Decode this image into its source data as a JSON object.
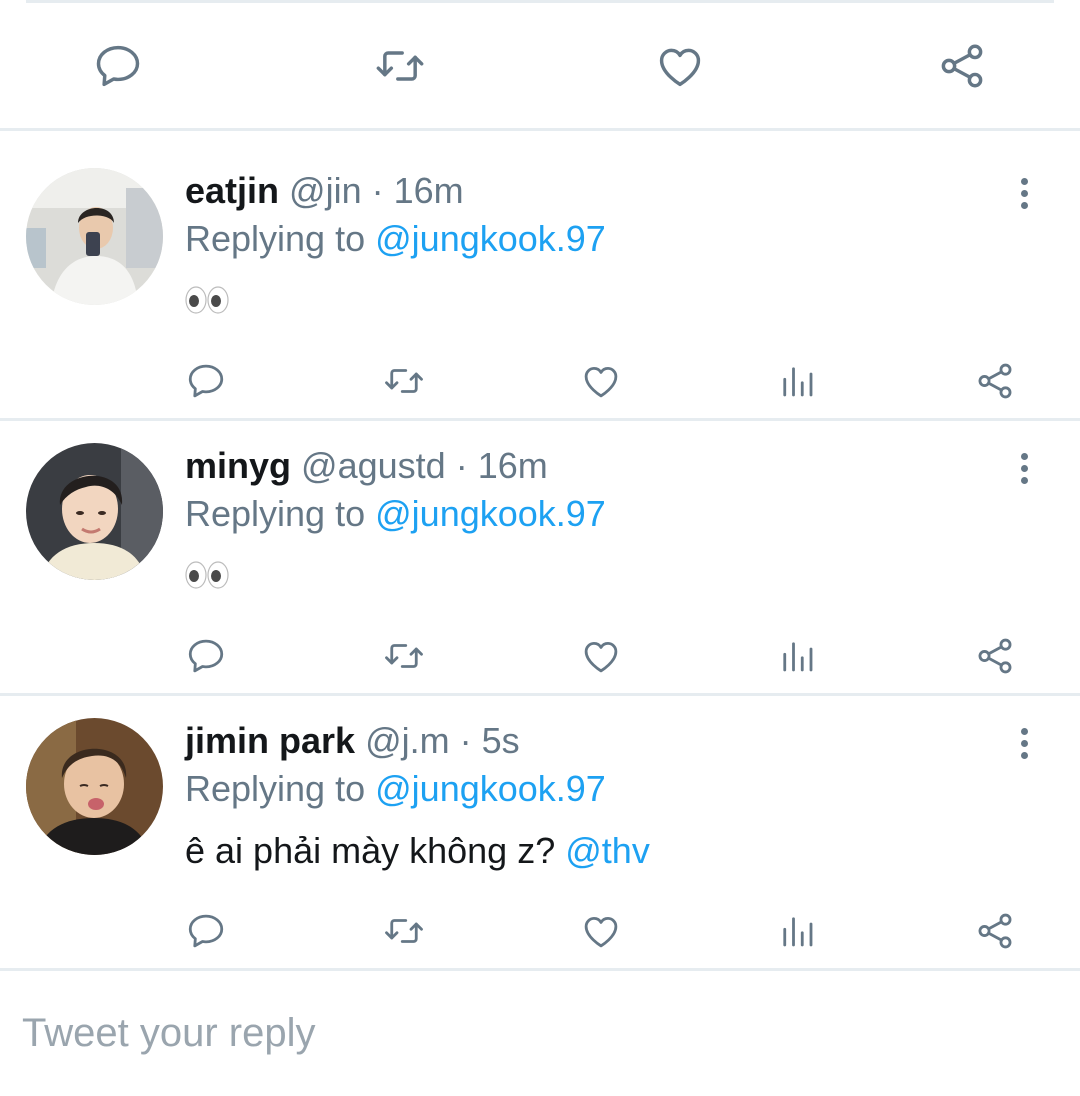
{
  "colors": {
    "icon": "#657786",
    "link": "#1da1f2",
    "separator": "#e6ecf0",
    "text": "#14171a"
  },
  "main_actions": [
    "reply-icon",
    "retweet-icon",
    "like-icon",
    "share-icon"
  ],
  "tweets": [
    {
      "name": "eatjin",
      "handle": "@jin",
      "sep": "·",
      "time": "16m",
      "replying_prefix": "Replying to",
      "replying_handle": "@jungkook.97",
      "body": "👀",
      "icons": [
        "reply-icon",
        "retweet-icon",
        "like-icon",
        "analytics-icon",
        "share-icon"
      ]
    },
    {
      "name": "minyg",
      "handle": "@agustd",
      "sep": "·",
      "time": "16m",
      "replying_prefix": "Replying to",
      "replying_handle": "@jungkook.97",
      "body": "👀",
      "icons": [
        "reply-icon",
        "retweet-icon",
        "like-icon",
        "analytics-icon",
        "share-icon"
      ]
    },
    {
      "name": "jimin park",
      "handle": "@j.m",
      "sep": "·",
      "time": "5s",
      "replying_prefix": "Replying to",
      "replying_handle": "@jungkook.97",
      "body": "ê ai phải mày không z?",
      "body_mention": "@thv",
      "icons": [
        "reply-icon",
        "retweet-icon",
        "like-icon",
        "analytics-icon",
        "share-icon"
      ]
    }
  ],
  "composer": {
    "placeholder": "Tweet your reply"
  }
}
